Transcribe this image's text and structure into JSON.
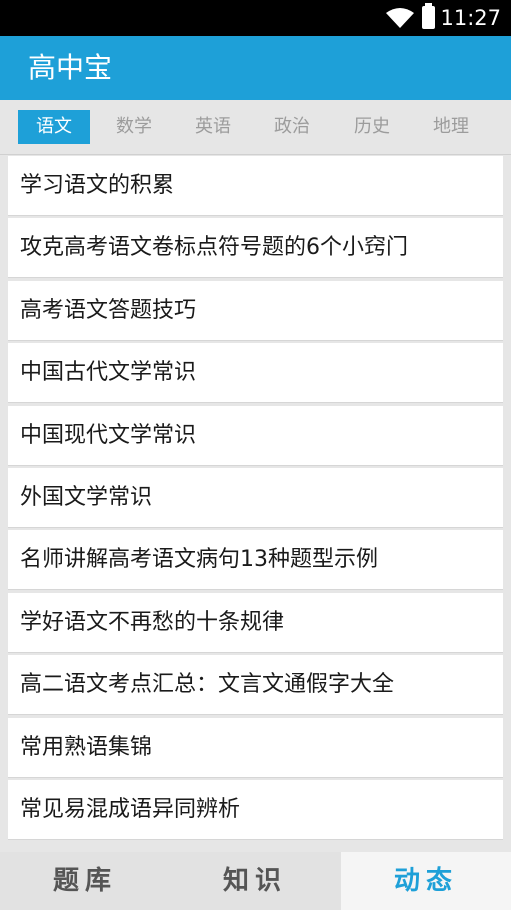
{
  "status": {
    "time": "11:27"
  },
  "app": {
    "title": "高中宝"
  },
  "tabs": [
    {
      "label": "语文",
      "active": true
    },
    {
      "label": "数学",
      "active": false
    },
    {
      "label": "英语",
      "active": false
    },
    {
      "label": "政治",
      "active": false
    },
    {
      "label": "历史",
      "active": false
    },
    {
      "label": "地理",
      "active": false
    }
  ],
  "list": {
    "items": [
      "学习语文的积累",
      "攻克高考语文卷标点符号题的6个小窍门",
      "高考语文答题技巧",
      "中国古代文学常识",
      "中国现代文学常识",
      "外国文学常识",
      "名师讲解高考语文病句13种题型示例",
      "学好语文不再愁的十条规律",
      "高二语文考点汇总：文言文通假字大全",
      "常用熟语集锦",
      "常见易混成语异同辨析"
    ]
  },
  "bottom_nav": [
    {
      "label": "题库",
      "active": false
    },
    {
      "label": "知识",
      "active": false
    },
    {
      "label": "动态",
      "active": true
    }
  ],
  "colors": {
    "accent": "#1ea0d8",
    "statusbar": "#000000",
    "background": "#e6e6e6"
  }
}
